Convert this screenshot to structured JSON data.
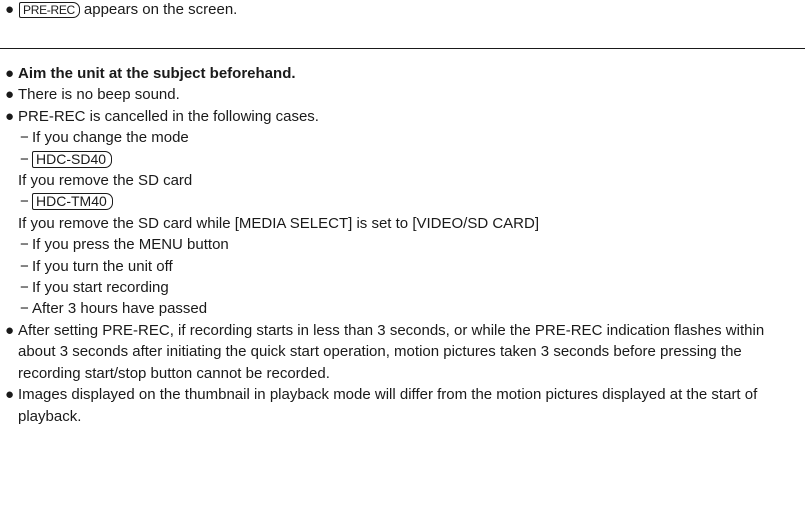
{
  "top": {
    "bullet": "●",
    "badge": "PRE-REC",
    "text": "appears on the screen."
  },
  "notes": {
    "bullet": "●",
    "dash": "−",
    "item1": "Aim the unit at the subject beforehand.",
    "item2": "There is no beep sound.",
    "item3": "PRE-REC is cancelled in the following cases.",
    "cases": {
      "c1": "If you change the mode",
      "c2_badge": "HDC-SD40",
      "c2_text": "If you remove the SD card",
      "c3_badge": "HDC-TM40",
      "c3_text": "If you remove the SD card while [MEDIA SELECT] is set to [VIDEO/SD CARD]",
      "c4": "If you press the MENU button",
      "c5": "If you turn the unit off",
      "c6": "If you start recording",
      "c7": "After 3 hours have passed"
    },
    "item4": "After setting PRE-REC, if recording starts in less than 3 seconds, or while the PRE-REC indication flashes within about 3 seconds after initiating the quick start operation, motion pictures taken 3 seconds before pressing the recording start/stop button cannot be recorded.",
    "item5": "Images displayed on the thumbnail in playback mode will differ from the motion pictures displayed at the start of playback."
  }
}
